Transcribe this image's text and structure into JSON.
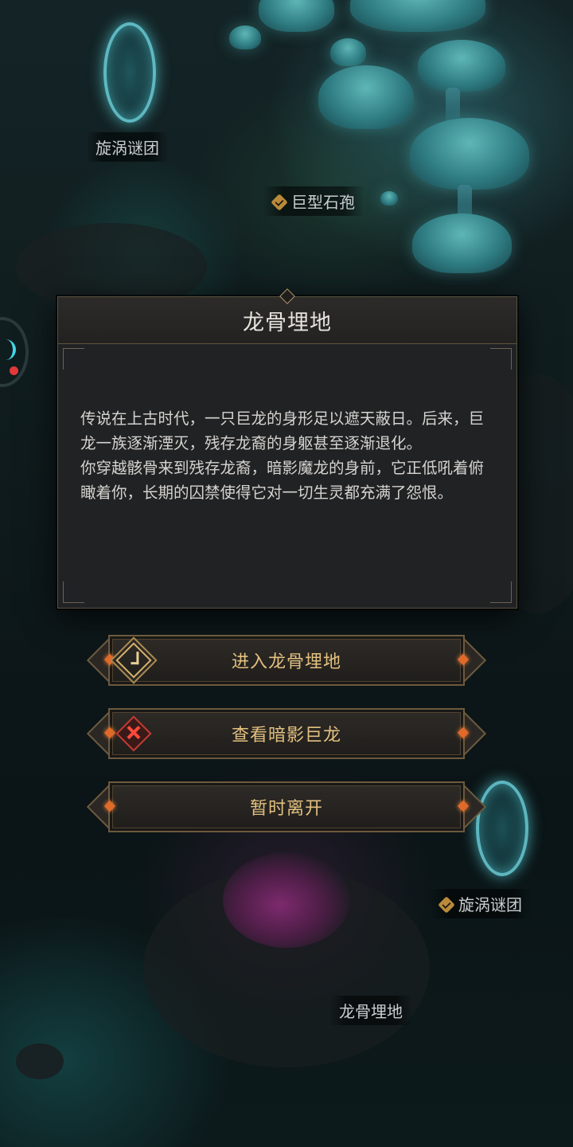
{
  "map": {
    "labels": {
      "vortex_top": "旋涡谜团",
      "giant_spore": "巨型石孢",
      "vortex_bottom": "旋涡谜团",
      "dragon_bone_land": "龙骨埋地"
    }
  },
  "dialog": {
    "title": "龙骨埋地",
    "paragraph1": "传说在上古时代，一只巨龙的身形足以遮天蔽日。后来，巨龙一族逐渐湮灭，残存龙裔的身躯甚至逐渐退化。",
    "paragraph2": "你穿越骸骨来到残存龙裔，暗影魔龙的身前，它正低吼着俯瞰着你，长期的囚禁使得它对一切生灵都充满了怨恨。"
  },
  "actions": {
    "enter": "进入龙骨埋地",
    "view": "查看暗影巨龙",
    "leave": "暂时离开"
  }
}
